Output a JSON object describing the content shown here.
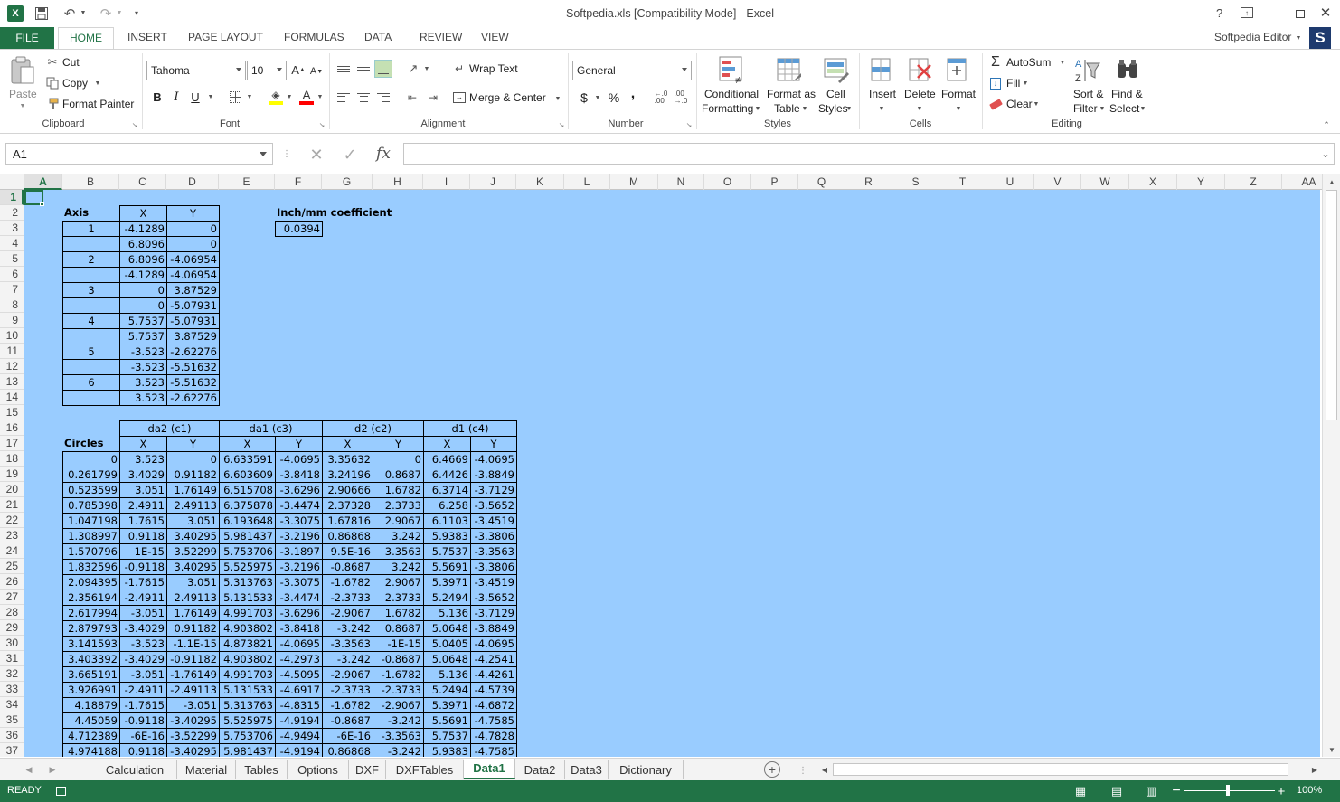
{
  "window": {
    "title": "Softpedia.xls  [Compatibility Mode] - Excel",
    "help": "?",
    "user": "Softpedia Editor",
    "avatar_letter": "S"
  },
  "tabs": [
    "FILE",
    "HOME",
    "INSERT",
    "PAGE LAYOUT",
    "FORMULAS",
    "DATA",
    "REVIEW",
    "VIEW"
  ],
  "clipboard": {
    "paste": "Paste",
    "cut": "Cut",
    "copy": "Copy",
    "format_painter": "Format Painter",
    "group": "Clipboard"
  },
  "font": {
    "name": "Tahoma",
    "size": "10",
    "bold": "B",
    "italic": "I",
    "underline": "U",
    "color_letter": "A",
    "group": "Font"
  },
  "alignment": {
    "wrap": "Wrap Text",
    "merge": "Merge & Center",
    "group": "Alignment"
  },
  "number": {
    "format": "General",
    "currency": "$",
    "percent": "%",
    "comma": ",",
    "group": "Number"
  },
  "styles": {
    "conditional": [
      "Conditional",
      "Formatting"
    ],
    "format_table": [
      "Format as",
      "Table"
    ],
    "cell_styles": [
      "Cell",
      "Styles"
    ],
    "group": "Styles"
  },
  "cells": {
    "insert": "Insert",
    "delete": "Delete",
    "format": "Format",
    "group": "Cells"
  },
  "editing": {
    "autosum": "AutoSum",
    "fill": "Fill",
    "clear": "Clear",
    "sort": [
      "Sort &",
      "Filter"
    ],
    "find": [
      "Find &",
      "Select"
    ],
    "group": "Editing"
  },
  "formula_bar": {
    "name_box": "A1",
    "fx": "fx",
    "value": ""
  },
  "columns": [
    "A",
    "B",
    "C",
    "D",
    "E",
    "F",
    "G",
    "H",
    "I",
    "J",
    "K",
    "L",
    "M",
    "N",
    "O",
    "P",
    "Q",
    "R",
    "S",
    "T",
    "U",
    "V",
    "W",
    "X",
    "Y",
    "Z",
    "AA"
  ],
  "rows": [
    "1",
    "2",
    "3",
    "4",
    "5",
    "6",
    "7",
    "8",
    "9",
    "10",
    "11",
    "12",
    "13",
    "14",
    "15",
    "16",
    "17",
    "18",
    "19",
    "20",
    "21",
    "22",
    "23",
    "24",
    "25",
    "26",
    "27",
    "28",
    "29",
    "30",
    "31",
    "32",
    "33",
    "34",
    "35",
    "36",
    "37"
  ],
  "axis_table": {
    "title": "Axis",
    "col_x": "X",
    "col_y": "Y",
    "rows": [
      [
        "1",
        "-4.1289",
        "0"
      ],
      [
        "",
        "6.8096",
        "0"
      ],
      [
        "2",
        "6.8096",
        "-4.06954"
      ],
      [
        "",
        "-4.1289",
        "-4.06954"
      ],
      [
        "3",
        "0",
        "3.87529"
      ],
      [
        "",
        "0",
        "-5.07931"
      ],
      [
        "4",
        "5.7537",
        "-5.07931"
      ],
      [
        "",
        "5.7537",
        "3.87529"
      ],
      [
        "5",
        "-3.523",
        "-2.62276"
      ],
      [
        "",
        "-3.523",
        "-5.51632"
      ],
      [
        "6",
        "3.523",
        "-5.51632"
      ],
      [
        "",
        "3.523",
        "-2.62276"
      ]
    ]
  },
  "coefficient": {
    "label": "Inch/mm coefficient",
    "value": "0.0394"
  },
  "circles_table": {
    "title": "Circles",
    "groups": [
      "da2 (c1)",
      "da1 (c3)",
      "d2 (c2)",
      "d1 (c4)"
    ],
    "sub": [
      "X",
      "Y",
      "X",
      "Y",
      "X",
      "Y",
      "X",
      "Y"
    ],
    "rows": [
      [
        "0",
        "3.523",
        "0",
        "6.633591",
        "-4.0695",
        "3.35632",
        "0",
        "6.4669",
        "-4.0695"
      ],
      [
        "0.261799",
        "3.4029",
        "0.91182",
        "6.603609",
        "-3.8418",
        "3.24196",
        "0.8687",
        "6.4426",
        "-3.8849"
      ],
      [
        "0.523599",
        "3.051",
        "1.76149",
        "6.515708",
        "-3.6296",
        "2.90666",
        "1.6782",
        "6.3714",
        "-3.7129"
      ],
      [
        "0.785398",
        "2.4911",
        "2.49113",
        "6.375878",
        "-3.4474",
        "2.37328",
        "2.3733",
        "6.258",
        "-3.5652"
      ],
      [
        "1.047198",
        "1.7615",
        "3.051",
        "6.193648",
        "-3.3075",
        "1.67816",
        "2.9067",
        "6.1103",
        "-3.4519"
      ],
      [
        "1.308997",
        "0.9118",
        "3.40295",
        "5.981437",
        "-3.2196",
        "0.86868",
        "3.242",
        "5.9383",
        "-3.3806"
      ],
      [
        "1.570796",
        "1E-15",
        "3.52299",
        "5.753706",
        "-3.1897",
        "9.5E-16",
        "3.3563",
        "5.7537",
        "-3.3563"
      ],
      [
        "1.832596",
        "-0.9118",
        "3.40295",
        "5.525975",
        "-3.2196",
        "-0.8687",
        "3.242",
        "5.5691",
        "-3.3806"
      ],
      [
        "2.094395",
        "-1.7615",
        "3.051",
        "5.313763",
        "-3.3075",
        "-1.6782",
        "2.9067",
        "5.3971",
        "-3.4519"
      ],
      [
        "2.356194",
        "-2.4911",
        "2.49113",
        "5.131533",
        "-3.4474",
        "-2.3733",
        "2.3733",
        "5.2494",
        "-3.5652"
      ],
      [
        "2.617994",
        "-3.051",
        "1.76149",
        "4.991703",
        "-3.6296",
        "-2.9067",
        "1.6782",
        "5.136",
        "-3.7129"
      ],
      [
        "2.879793",
        "-3.4029",
        "0.91182",
        "4.903802",
        "-3.8418",
        "-3.242",
        "0.8687",
        "5.0648",
        "-3.8849"
      ],
      [
        "3.141593",
        "-3.523",
        "-1.1E-15",
        "4.873821",
        "-4.0695",
        "-3.3563",
        "-1E-15",
        "5.0405",
        "-4.0695"
      ],
      [
        "3.403392",
        "-3.4029",
        "-0.91182",
        "4.903802",
        "-4.2973",
        "-3.242",
        "-0.8687",
        "5.0648",
        "-4.2541"
      ],
      [
        "3.665191",
        "-3.051",
        "-1.76149",
        "4.991703",
        "-4.5095",
        "-2.9067",
        "-1.6782",
        "5.136",
        "-4.4261"
      ],
      [
        "3.926991",
        "-2.4911",
        "-2.49113",
        "5.131533",
        "-4.6917",
        "-2.3733",
        "-2.3733",
        "5.2494",
        "-4.5739"
      ],
      [
        "4.18879",
        "-1.7615",
        "-3.051",
        "5.313763",
        "-4.8315",
        "-1.6782",
        "-2.9067",
        "5.3971",
        "-4.6872"
      ],
      [
        "4.45059",
        "-0.9118",
        "-3.40295",
        "5.525975",
        "-4.9194",
        "-0.8687",
        "-3.242",
        "5.5691",
        "-4.7585"
      ],
      [
        "4.712389",
        "-6E-16",
        "-3.52299",
        "5.753706",
        "-4.9494",
        "-6E-16",
        "-3.3563",
        "5.7537",
        "-4.7828"
      ],
      [
        "4.974188",
        "0.9118",
        "-3.40295",
        "5.981437",
        "-4.9194",
        "0.86868",
        "-3.242",
        "5.9383",
        "-4.7585"
      ]
    ]
  },
  "sheet_tabs": [
    "Calculation",
    "Material",
    "Tables",
    "Options",
    "DXF",
    "DXFTables",
    "Data1",
    "Data2",
    "Data3",
    "Dictionary"
  ],
  "active_sheet": "Data1",
  "status": {
    "mode": "READY",
    "zoom": "100%"
  },
  "colors": {
    "excel_green": "#217346",
    "cell_fill": "#99ccff"
  }
}
